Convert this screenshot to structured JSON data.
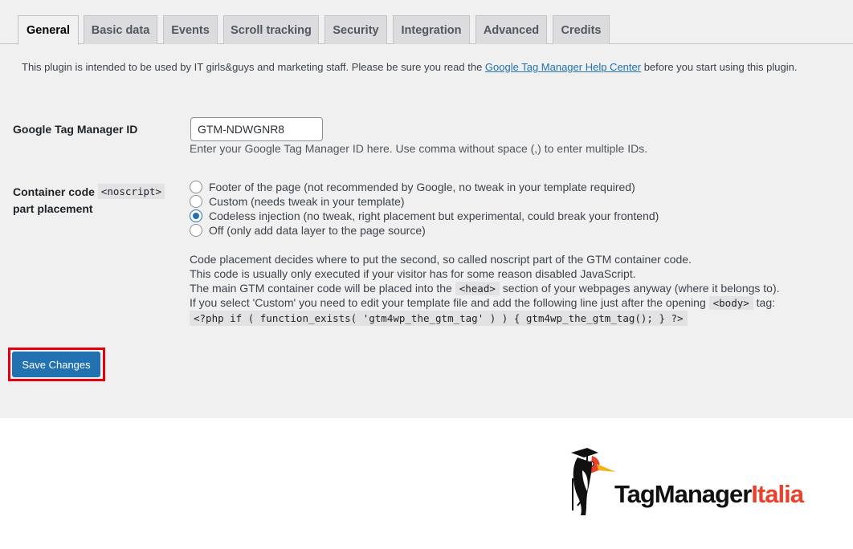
{
  "tabs": [
    {
      "label": "General",
      "active": true
    },
    {
      "label": "Basic data"
    },
    {
      "label": "Events"
    },
    {
      "label": "Scroll tracking"
    },
    {
      "label": "Security"
    },
    {
      "label": "Integration"
    },
    {
      "label": "Advanced"
    },
    {
      "label": "Credits"
    }
  ],
  "intro": {
    "before": "This plugin is intended to be used by IT girls&guys and marketing staff. Please be sure you read the ",
    "link": "Google Tag Manager Help Center",
    "after": " before you start using this plugin."
  },
  "gtm_id": {
    "label": "Google Tag Manager ID",
    "value": "GTM-NDWGNR8",
    "description": "Enter your Google Tag Manager ID here. Use comma without space (,) to enter multiple IDs."
  },
  "placement": {
    "label_before": "Container code",
    "label_code": "<noscript>",
    "label_after": "part placement",
    "options": [
      {
        "label": "Footer of the page (not recommended by Google, no tweak in your template required)",
        "checked": false
      },
      {
        "label": "Custom (needs tweak in your template)",
        "checked": false
      },
      {
        "label": "Codeless injection (no tweak, right placement but experimental, could break your frontend)",
        "checked": true
      },
      {
        "label": "Off (only add data layer to the page source)",
        "checked": false
      }
    ],
    "explanation": {
      "line1": "Code placement decides where to put the second, so called noscript part of the GTM container code.",
      "line2": "This code is usually only executed if your visitor has for some reason disabled JavaScript.",
      "line3_before": "The main GTM container code will be placed into the ",
      "line3_code": "<head>",
      "line3_after": " section of your webpages anyway (where it belongs to).",
      "line4_before": "If you select 'Custom' you need to edit your template file and add the following line just after the opening ",
      "line4_code": "<body>",
      "line4_after": " tag:",
      "php_line": "<?php if ( function_exists( 'gtm4wp_the_gtm_tag' ) ) { gtm4wp_the_gtm_tag(); } ?>"
    }
  },
  "save_button": "Save Changes",
  "logo": {
    "part1": "TagManager",
    "part2": "Italia"
  },
  "colors": {
    "primary": "#2271b1",
    "highlight": "#e4000f",
    "brand_red": "#e8412c",
    "admin_bg": "#f0f0f1"
  }
}
